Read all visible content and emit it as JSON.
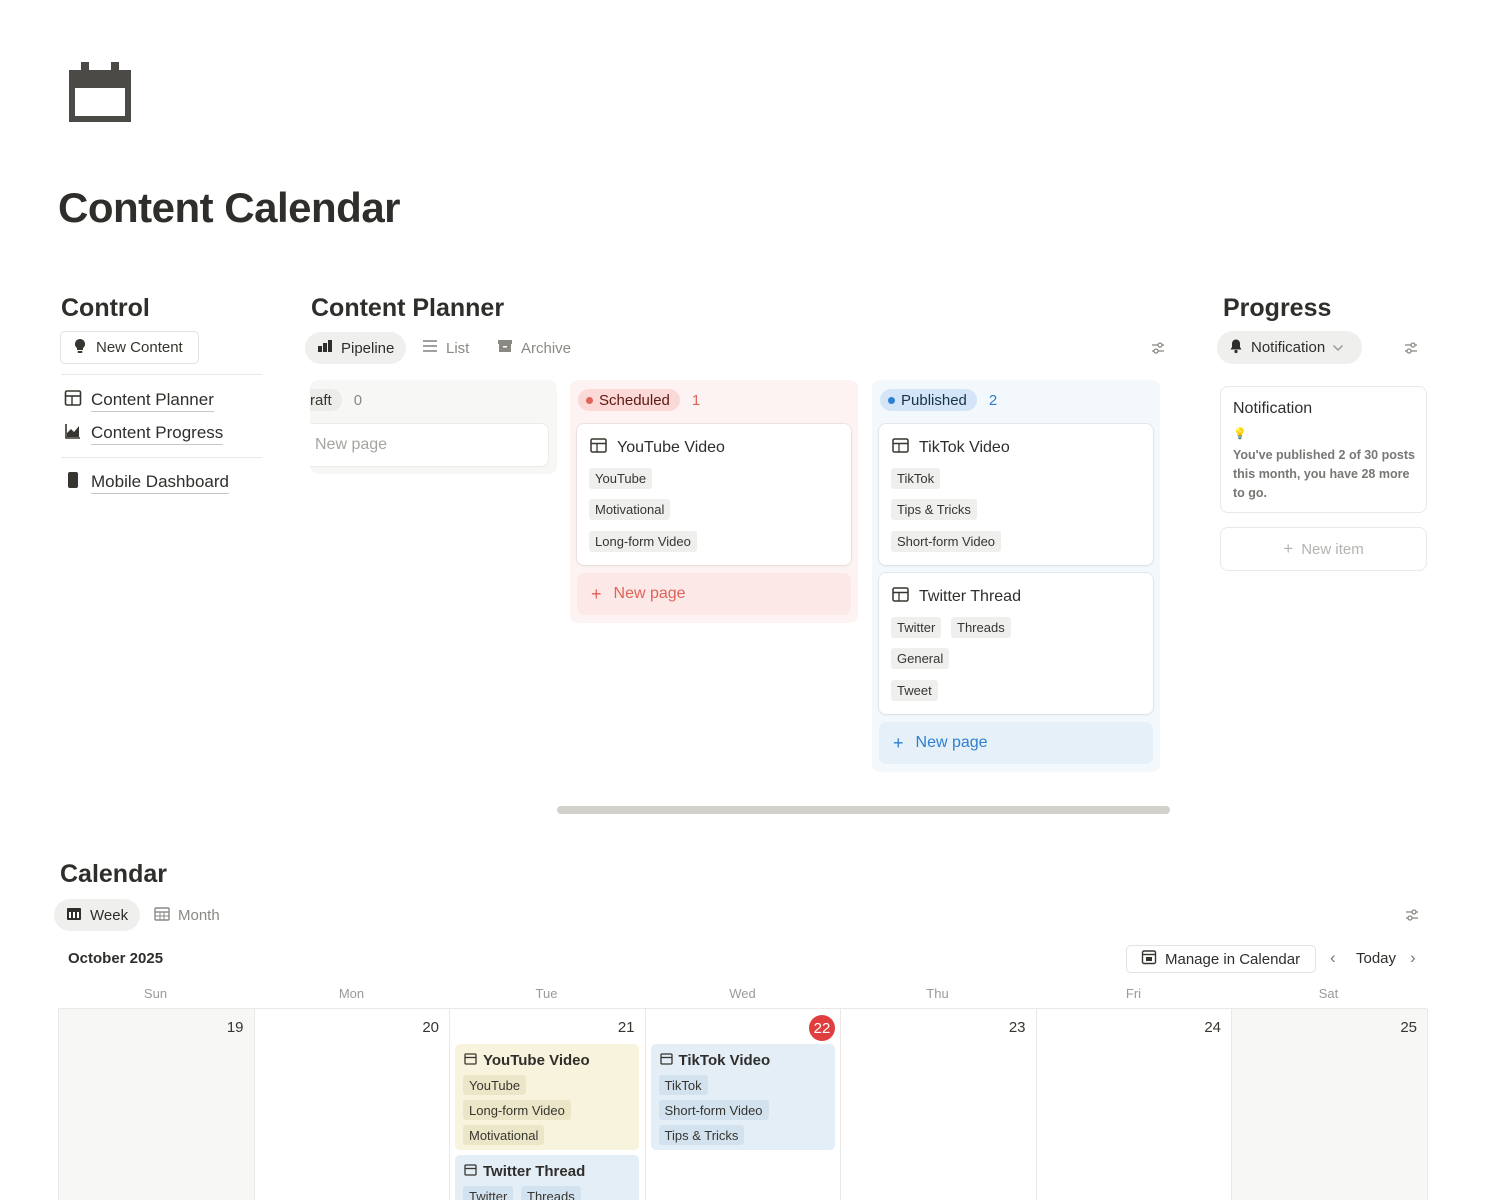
{
  "page": {
    "title": "Content Calendar"
  },
  "control": {
    "title": "Control",
    "new_content_label": "New Content",
    "links": [
      {
        "label": "Content Planner",
        "icon": "table-icon"
      },
      {
        "label": "Content Progress",
        "icon": "chart-icon"
      },
      {
        "label": "Mobile Dashboard",
        "icon": "phone-icon"
      }
    ]
  },
  "planner": {
    "title": "Content Planner",
    "tabs": [
      {
        "label": "Pipeline",
        "active": true
      },
      {
        "label": "List",
        "active": false
      },
      {
        "label": "Archive",
        "active": false
      }
    ],
    "columns": [
      {
        "name": "raft",
        "count": "0",
        "new_page": "New page"
      },
      {
        "name": "Scheduled",
        "count": "1",
        "color": "#e16259",
        "pill_bg": "#fbd9d6",
        "new_page": "New page",
        "cards": [
          {
            "title": "YouTube Video",
            "tags": [
              "YouTube",
              "Motivational",
              "Long-form Video"
            ]
          }
        ]
      },
      {
        "name": "Published",
        "count": "2",
        "color": "#2e7fd1",
        "pill_bg": "#d3e5f6",
        "new_page": "New page",
        "cards": [
          {
            "title": "TikTok Video",
            "tags": [
              "TikTok",
              "Tips & Tricks",
              "Short-form Video"
            ]
          },
          {
            "title": "Twitter Thread",
            "tags": [
              "Twitter",
              "Threads",
              "General",
              "Tweet"
            ]
          }
        ]
      }
    ]
  },
  "progress": {
    "title": "Progress",
    "view_label": "Notification",
    "card_title": "Notification",
    "card_emoji": "💡",
    "card_body": "You've published 2 of 30 posts this month, you have 28 more to go.",
    "new_item": "New item"
  },
  "calendar": {
    "title": "Calendar",
    "tabs": [
      {
        "label": "Week",
        "active": true
      },
      {
        "label": "Month",
        "active": false
      }
    ],
    "month": "October 2025",
    "manage_label": "Manage in Calendar",
    "today_label": "Today",
    "days": [
      {
        "dow": "Sun",
        "num": "19"
      },
      {
        "dow": "Mon",
        "num": "20"
      },
      {
        "dow": "Tue",
        "num": "21"
      },
      {
        "dow": "Wed",
        "num": "22",
        "today": true
      },
      {
        "dow": "Thu",
        "num": "23"
      },
      {
        "dow": "Fri",
        "num": "24"
      },
      {
        "dow": "Sat",
        "num": "25"
      }
    ],
    "events": {
      "tue": [
        {
          "title": "YouTube Video",
          "tags": [
            "YouTube",
            "Long-form Video",
            "Motivational"
          ]
        },
        {
          "title": "Twitter Thread",
          "tags": [
            "Twitter",
            "Threads"
          ]
        }
      ],
      "wed": [
        {
          "title": "TikTok Video",
          "tags": [
            "TikTok",
            "Short-form Video",
            "Tips & Tricks"
          ]
        }
      ]
    }
  }
}
